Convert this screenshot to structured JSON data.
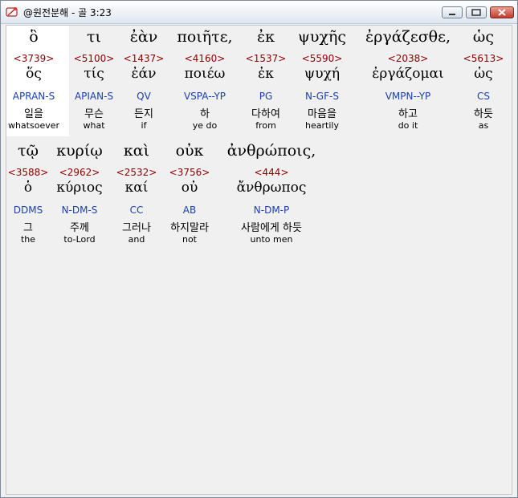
{
  "window": {
    "title": "@원전분해 - 골 3:23"
  },
  "rows": [
    [
      {
        "greek": "ὃ",
        "strong": "<3739>",
        "lemma": "ὅς",
        "morph": "APRAN-S",
        "kor": "일을",
        "eng": "whatsoever"
      },
      {
        "greek": "τι",
        "strong": "<5100>",
        "lemma": "τίς",
        "morph": "APIAN-S",
        "kor": "무슨",
        "eng": "what"
      },
      {
        "greek": "ἐὰν",
        "strong": "<1437>",
        "lemma": "ἐάν",
        "morph": "QV",
        "kor": "든지",
        "eng": "if"
      },
      {
        "greek": "ποιῆτε,",
        "strong": "<4160>",
        "lemma": "ποιέω",
        "morph": "VSPA--YP",
        "kor": "하",
        "eng": "ye do"
      },
      {
        "greek": "ἐκ",
        "strong": "<1537>",
        "lemma": "ἐκ",
        "morph": "PG",
        "kor": "다하여",
        "eng": "from"
      },
      {
        "greek": "ψυχῆς",
        "strong": "<5590>",
        "lemma": "ψυχή",
        "morph": "N-GF-S",
        "kor": "마음을",
        "eng": "heartily"
      },
      {
        "greek": "ἐργάζεσθε,",
        "strong": "<2038>",
        "lemma": "ἐργάζομαι",
        "morph": "VMPN--YP",
        "kor": "하고",
        "eng": "do it"
      },
      {
        "greek": "ὡς",
        "strong": "<5613>",
        "lemma": "ὡς",
        "morph": "CS",
        "kor": "하듯",
        "eng": "as"
      }
    ],
    [
      {
        "greek": "τῷ",
        "strong": "<3588>",
        "lemma": "ὁ",
        "morph": "DDMS",
        "kor": "그",
        "eng": "the"
      },
      {
        "greek": "κυρίῳ",
        "strong": "<2962>",
        "lemma": "κύριος",
        "morph": "N-DM-S",
        "kor": "주께",
        "eng": "to-Lord"
      },
      {
        "greek": "καὶ",
        "strong": "<2532>",
        "lemma": "καί",
        "morph": "CC",
        "kor": "그러나",
        "eng": "and"
      },
      {
        "greek": "οὐκ",
        "strong": "<3756>",
        "lemma": "οὐ",
        "morph": "AB",
        "kor": "하지말라",
        "eng": "not"
      },
      {
        "greek": "ἀνθρώποις,",
        "strong": "<444>",
        "lemma": "ἄνθρωπος",
        "morph": "N-DM-P",
        "kor": "사람에게 하듯",
        "eng": "unto men"
      }
    ]
  ]
}
